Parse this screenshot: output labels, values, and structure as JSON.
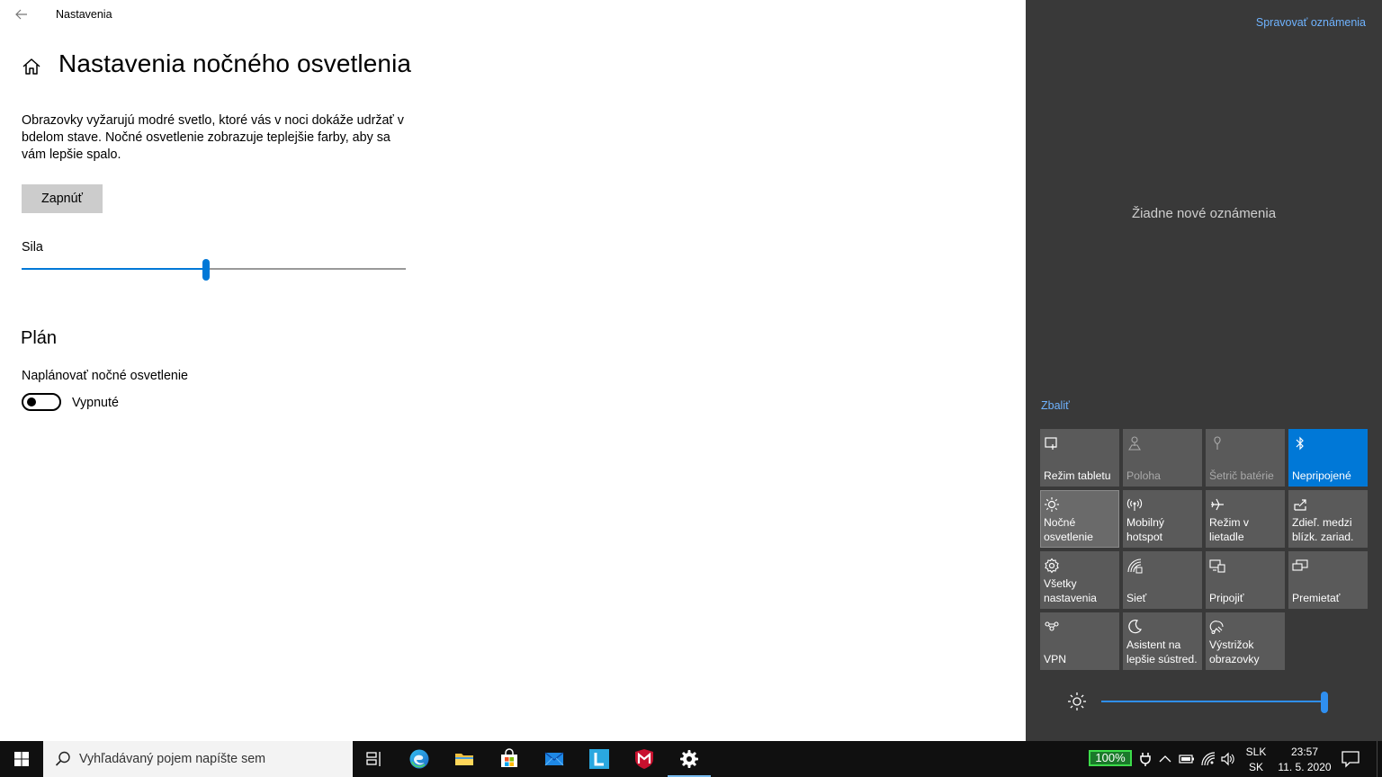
{
  "settings": {
    "window_title": "Nastavenia",
    "page_title": "Nastavenia nočného osvetlenia",
    "description": "Obrazovky vyžarujú modré svetlo, ktoré vás v noci dokáže udržať v bdelom stave. Nočné osvetlenie zobrazuje teplejšie farby, aby sa vám lepšie spalo.",
    "turn_on_button": "Zapnúť",
    "strength_label": "Sila",
    "strength_value": 48,
    "plan_heading": "Plán",
    "schedule_label": "Naplánovať nočné osvetlenie",
    "schedule_state": "Vypnuté",
    "schedule_on": false
  },
  "action_center": {
    "manage_notifications": "Spravovať oznámenia",
    "no_notifications": "Žiadne nové oznámenia",
    "collapse": "Zbaliť",
    "tiles": [
      {
        "label": "Režim tabletu",
        "icon": "tablet-mode-icon",
        "state": "off"
      },
      {
        "label": "Poloha",
        "icon": "location-icon",
        "state": "disabled"
      },
      {
        "label": "Šetrič batérie",
        "icon": "battery-saver-icon",
        "state": "disabled"
      },
      {
        "label": "Nepripojené",
        "icon": "bluetooth-icon",
        "state": "active"
      },
      {
        "label": "Nočné osvetlenie",
        "icon": "night-light-icon",
        "state": "highlight"
      },
      {
        "label": "Mobilný hotspot",
        "icon": "hotspot-icon",
        "state": "off"
      },
      {
        "label": "Režim v lietadle",
        "icon": "airplane-icon",
        "state": "off"
      },
      {
        "label": "Zdieľ. medzi blízk. zariad.",
        "icon": "nearby-share-icon",
        "state": "off"
      },
      {
        "label": "Všetky nastavenia",
        "icon": "gear-icon",
        "state": "off"
      },
      {
        "label": "Sieť",
        "icon": "network-icon",
        "state": "off"
      },
      {
        "label": "Pripojiť",
        "icon": "connect-icon",
        "state": "off"
      },
      {
        "label": "Premietať",
        "icon": "project-icon",
        "state": "off"
      },
      {
        "label": "VPN",
        "icon": "vpn-icon",
        "state": "off"
      },
      {
        "label": "Asistent na lepšie sústred.",
        "icon": "focus-assist-icon",
        "state": "off"
      },
      {
        "label": "Výstrižok obrazovky",
        "icon": "screen-snip-icon",
        "state": "off"
      }
    ],
    "brightness_value": 100
  },
  "taskbar": {
    "search_placeholder": "Vyhľadávaný pojem napíšte sem",
    "battery_percent": "100%",
    "language_top": "SLK",
    "language_bottom": "SK",
    "time": "23:57",
    "date": "11. 5. 2020"
  },
  "colors": {
    "accent": "#0078d7",
    "action_center_bg": "#393939",
    "tile_bg": "#5a5a5a",
    "taskbar_bg": "#101010"
  }
}
